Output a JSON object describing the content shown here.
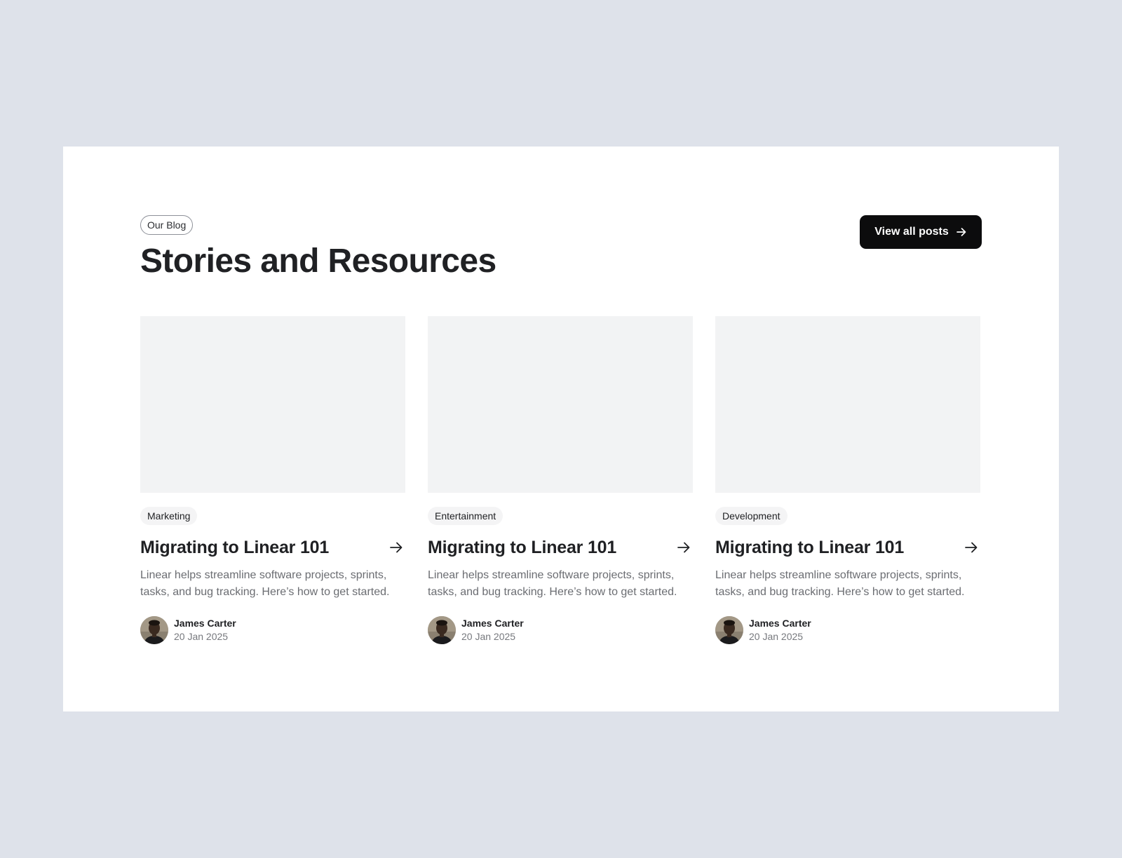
{
  "section": {
    "eyebrow": "Our Blog",
    "title": "Stories and Resources",
    "cta_label": "View all posts"
  },
  "posts": [
    {
      "category": "Marketing",
      "title": "Migrating to Linear 101",
      "excerpt": "Linear helps streamline software projects, sprints, tasks, and bug tracking. Here’s how to get started.",
      "author": "James Carter",
      "date": "20 Jan 2025"
    },
    {
      "category": "Entertainment",
      "title": "Migrating to Linear 101",
      "excerpt": "Linear helps streamline software projects, sprints, tasks, and bug tracking. Here’s how to get started.",
      "author": "James Carter",
      "date": "20 Jan 2025"
    },
    {
      "category": "Development",
      "title": "Migrating to Linear 101",
      "excerpt": "Linear helps streamline software projects, sprints, tasks, and bug tracking. Here’s how to get started.",
      "author": "James Carter",
      "date": "20 Jan 2025"
    }
  ],
  "icons": {
    "cta_icon": "arrow-right-icon",
    "post_link_icon": "arrow-right-icon",
    "avatar": "avatar-photo"
  },
  "colors": {
    "page_background": "#dee2ea",
    "panel_background": "#ffffff",
    "cta_background": "#0c0c0d",
    "thumbnail_placeholder": "#f2f3f4",
    "tag_background": "#f4f4f5",
    "body_text": "#6b6d72"
  }
}
